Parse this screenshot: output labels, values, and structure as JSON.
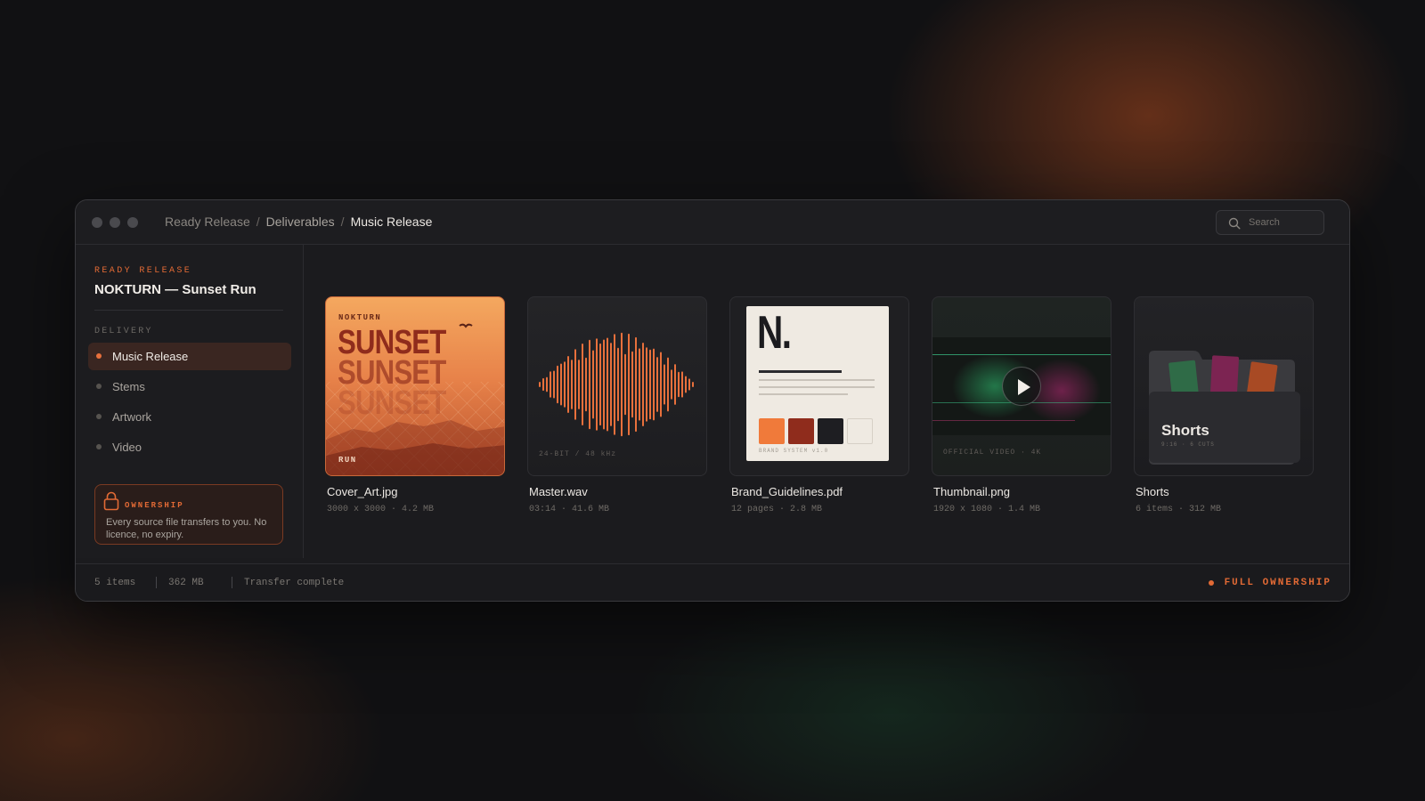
{
  "window": {
    "controls": [
      "close",
      "minimize",
      "zoom"
    ]
  },
  "breadcrumb": {
    "items": [
      "Ready Release",
      "Deliverables",
      "Music Release"
    ],
    "separator": "/"
  },
  "search": {
    "placeholder": "Search",
    "icon": "search-icon"
  },
  "sidebar": {
    "eyebrow": "READY RELEASE",
    "project_title": "NOKTURN — Sunset Run",
    "section_label": "DELIVERY",
    "items": [
      {
        "label": "Music Release",
        "active": true
      },
      {
        "label": "Stems",
        "active": false
      },
      {
        "label": "Artwork",
        "active": false
      },
      {
        "label": "Video",
        "active": false
      }
    ],
    "ownership": {
      "icon": "lock-icon",
      "title": "OWNERSHIP",
      "text": "Every source file transfers to you. No licence, no expiry."
    }
  },
  "files": [
    {
      "name": "Cover_Art.jpg",
      "meta": "3000 x 3000 · 4.2 MB",
      "thumb": {
        "artist": "NOKTURN",
        "headline": "SUNSET",
        "footer": "RUN"
      }
    },
    {
      "name": "Master.wav",
      "meta": "03:14 · 41.6 MB",
      "thumb": {
        "caption": "24-BIT / 48 kHz"
      }
    },
    {
      "name": "Brand_Guidelines.pdf",
      "meta": "12 pages · 2.8 MB",
      "thumb": {
        "logo": "N.",
        "caption": "BRAND SYSTEM v1.0",
        "swatches": [
          "#f07a3a",
          "#8f2c1c",
          "#1e1e22",
          "#efeae2"
        ]
      }
    },
    {
      "name": "Thumbnail.png",
      "meta": "1920 x 1080 · 1.4 MB",
      "thumb": {
        "caption": "OFFICIAL VIDEO · 4K",
        "icon": "play-icon"
      }
    },
    {
      "name": "Shorts",
      "meta": "6 items · 312 MB",
      "thumb": {
        "folder_label": "Shorts",
        "folder_meta": "9:16 · 6 CUTS",
        "icon": "folder-icon"
      }
    }
  ],
  "statusbar": {
    "items": "5 items",
    "size": "362 MB",
    "status": "Transfer complete",
    "badge": "FULL OWNERSHIP"
  },
  "colors": {
    "accent": "#e26a35",
    "window_bg": "#1b1b1e",
    "active_nav_bg": "#3a2621"
  }
}
